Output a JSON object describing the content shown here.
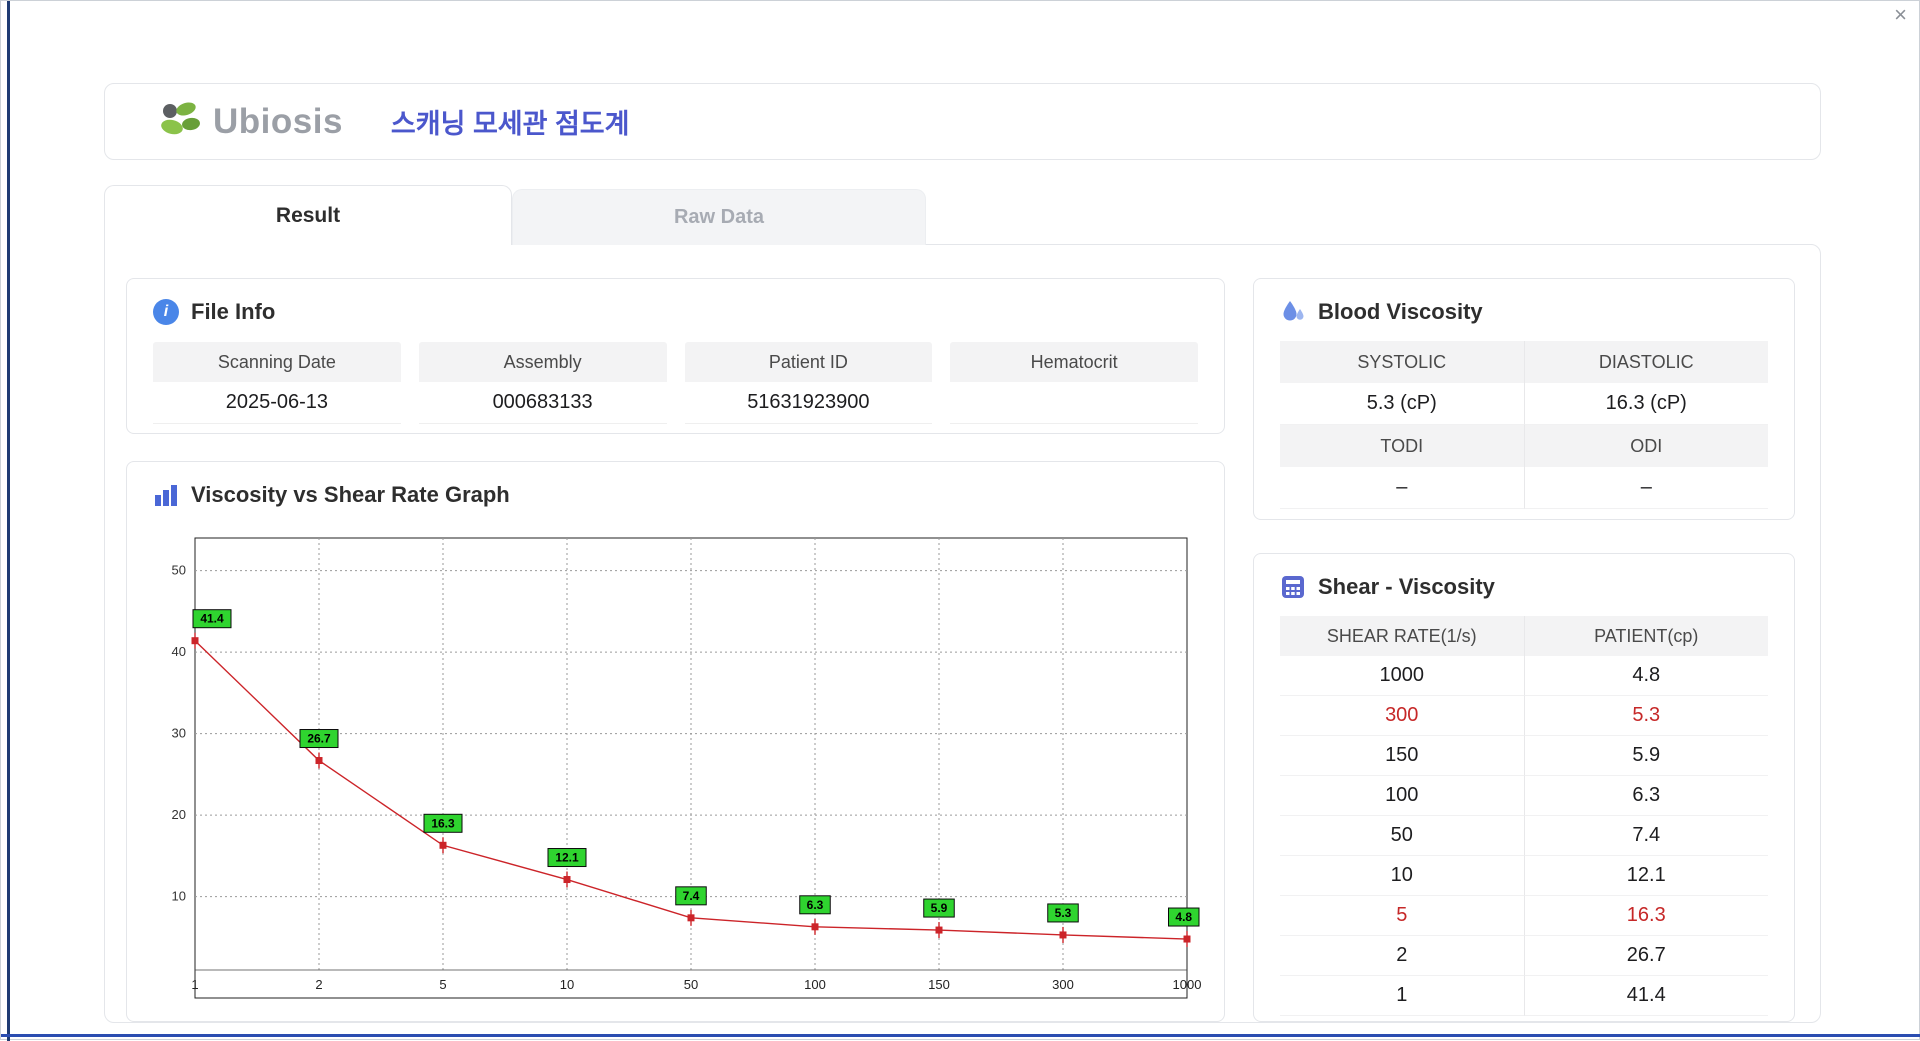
{
  "window": {
    "close_label": "×"
  },
  "header": {
    "brand": "Ubiosis",
    "app_title": "스캐닝 모세관 점도계"
  },
  "tabs": [
    {
      "label": "Result"
    },
    {
      "label": "Raw Data"
    }
  ],
  "file_info": {
    "title": "File Info",
    "fields": [
      {
        "label": "Scanning Date",
        "value": "2025-06-13"
      },
      {
        "label": "Assembly",
        "value": "000683133"
      },
      {
        "label": "Patient ID",
        "value": "51631923900"
      },
      {
        "label": "Hematocrit",
        "value": ""
      }
    ]
  },
  "blood_viscosity": {
    "title": "Blood Viscosity",
    "rows": [
      {
        "type": "header",
        "cells": [
          "SYSTOLIC",
          "DIASTOLIC"
        ]
      },
      {
        "type": "value",
        "cells": [
          "5.3 (cP)",
          "16.3 (cP)"
        ]
      },
      {
        "type": "header",
        "cells": [
          "TODI",
          "ODI"
        ]
      },
      {
        "type": "value",
        "cells": [
          "–",
          "–"
        ]
      }
    ]
  },
  "shear_viscosity": {
    "title": "Shear - Viscosity",
    "columns": [
      "SHEAR RATE(1/s)",
      "PATIENT(cp)"
    ],
    "rows": [
      {
        "shear_rate": "1000",
        "patient": "4.8",
        "highlight": false
      },
      {
        "shear_rate": "300",
        "patient": "5.3",
        "highlight": true
      },
      {
        "shear_rate": "150",
        "patient": "5.9",
        "highlight": false
      },
      {
        "shear_rate": "100",
        "patient": "6.3",
        "highlight": false
      },
      {
        "shear_rate": "50",
        "patient": "7.4",
        "highlight": false
      },
      {
        "shear_rate": "10",
        "patient": "12.1",
        "highlight": false
      },
      {
        "shear_rate": "5",
        "patient": "16.3",
        "highlight": true
      },
      {
        "shear_rate": "2",
        "patient": "26.7",
        "highlight": false
      },
      {
        "shear_rate": "1",
        "patient": "41.4",
        "highlight": false
      }
    ]
  },
  "chart_data": {
    "type": "line",
    "title": "Viscosity vs Shear Rate Graph",
    "xlabel": "",
    "ylabel": "",
    "x_categories": [
      "1",
      "2",
      "5",
      "10",
      "50",
      "100",
      "150",
      "300",
      "1000"
    ],
    "series": [
      {
        "name": "Patient",
        "values": [
          41.4,
          26.7,
          16.3,
          12.1,
          7.4,
          6.3,
          5.9,
          5.3,
          4.8
        ]
      }
    ],
    "point_labels": [
      "41.4",
      "26.7",
      "16.3",
      "12.1",
      "7.4",
      "6.3",
      "5.9",
      "5.3",
      "4.8"
    ],
    "yticks": [
      10,
      20,
      30,
      40,
      50
    ],
    "ylim": [
      1,
      54
    ],
    "grid": "dotted",
    "x_scale": "categorical",
    "legend": "none",
    "line_color": "#cc2429",
    "marker": "square",
    "label_bg": "#2fd42f"
  }
}
